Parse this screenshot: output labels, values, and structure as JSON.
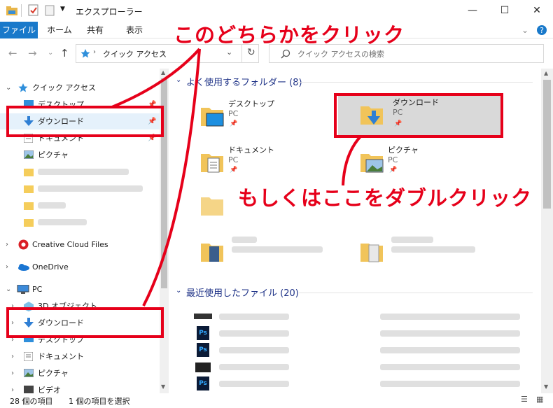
{
  "window": {
    "title": "エクスプローラー"
  },
  "ribbon": {
    "tabs": [
      "ファイル",
      "ホーム",
      "共有",
      "表示"
    ]
  },
  "address": {
    "path": "クイック アクセス",
    "search_placeholder": "クイック アクセスの検索"
  },
  "nav": {
    "quick_access": "クイック アクセス",
    "qa_items": [
      "デスクトップ",
      "ダウンロード",
      "ドキュメント",
      "ピクチャ"
    ],
    "creative_cloud": "Creative Cloud Files",
    "onedrive": "OneDrive",
    "pc": "PC",
    "pc_items": [
      "3D オブジェクト",
      "ダウンロード",
      "デスクトップ",
      "ドキュメント",
      "ピクチャ",
      "ビデオ"
    ]
  },
  "main": {
    "frequent_header": "よく使用するフォルダー (8)",
    "tiles": [
      {
        "name": "デスクトップ",
        "sub": "PC"
      },
      {
        "name": "ダウンロード",
        "sub": "PC"
      },
      {
        "name": "ドキュメント",
        "sub": "PC"
      },
      {
        "name": "ピクチャ",
        "sub": "PC"
      }
    ],
    "recent_header": "最近使用したファイル (20)"
  },
  "status": {
    "count": "28 個の項目",
    "selected": "1 個の項目を選択"
  },
  "annotations": {
    "top": "このどちらかをクリック",
    "middle": "もしくはここをダブルクリック"
  },
  "colors": {
    "accent": "#1979ca",
    "annotation": "#e6001a",
    "selected": "#d9d9d9"
  }
}
